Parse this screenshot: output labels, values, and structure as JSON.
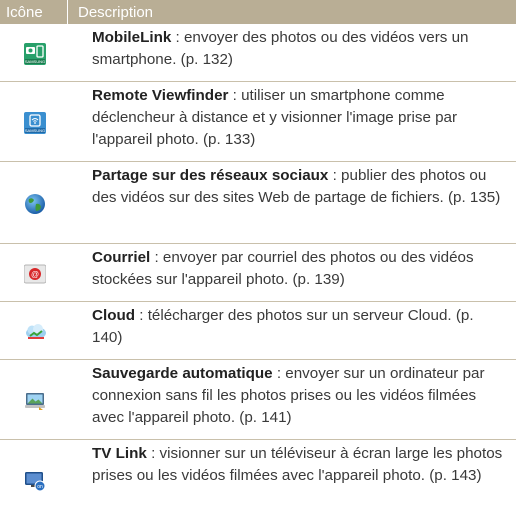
{
  "header": {
    "icon_label": "Icône",
    "description_label": "Description"
  },
  "rows": [
    {
      "icon": "mobilelink-icon",
      "icon_text": "SAMSUNG",
      "title": "MobileLink",
      "text": " : envoyer des photos ou des vidéos vers un smartphone. (p. 132)"
    },
    {
      "icon": "remote-viewfinder-icon",
      "icon_text": "SAMSUNG",
      "title": "Remote Viewfinder",
      "text": " : utiliser un smartphone comme déclencheur à distance et y visionner l'image prise par l'appareil photo. (p. 133)"
    },
    {
      "icon": "globe-icon",
      "title": "Partage sur des réseaux sociaux",
      "text": " : publier des photos ou des vidéos sur des sites Web de partage de fichiers. (p. 135)"
    },
    {
      "icon": "email-icon",
      "title": "Courriel",
      "text": " : envoyer par courriel des photos ou des vidéos stockées sur l'appareil photo. (p. 139)"
    },
    {
      "icon": "cloud-icon",
      "title": "Cloud",
      "text": " : télécharger des photos sur un serveur Cloud. (p. 140)"
    },
    {
      "icon": "auto-backup-icon",
      "title": "Sauvegarde automatique",
      "text": " : envoyer sur un ordinateur par connexion sans fil les photos prises ou les vidéos filmées avec l'appareil photo. (p. 141)"
    },
    {
      "icon": "tv-link-icon",
      "title": "TV Link",
      "text": " : visionner sur un téléviseur à écran large les photos prises ou les vidéos filmées avec l'appareil photo. (p. 143)"
    }
  ],
  "colors": {
    "header_bg": "#b9ae95",
    "row_border": "#c9c0ab",
    "text": "#3a3a3a"
  }
}
